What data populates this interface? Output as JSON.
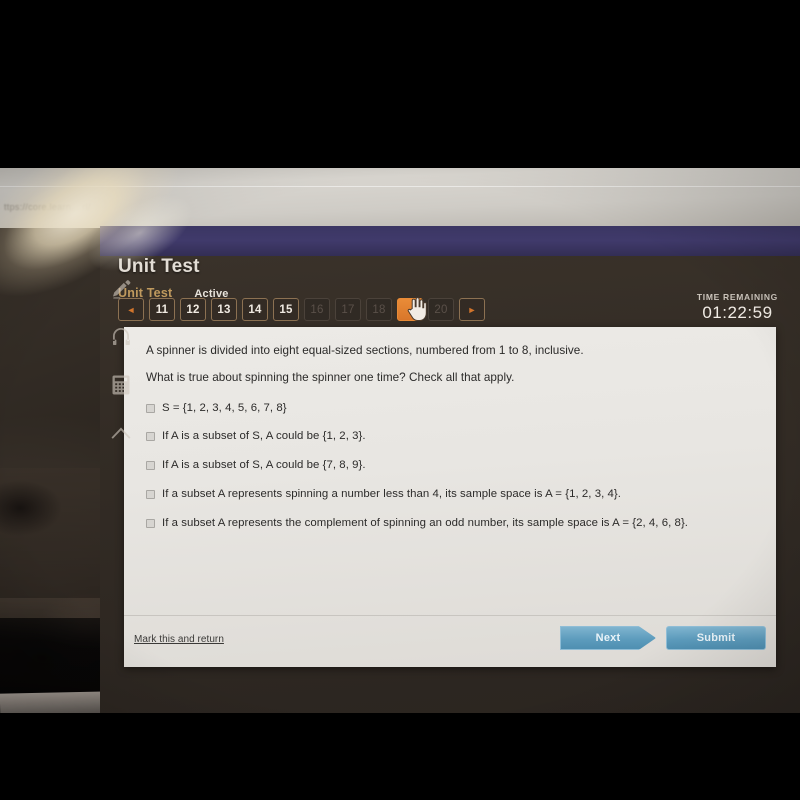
{
  "browser": {
    "url_fragment": "ttps://core.learn...                             rl/"
  },
  "app": {
    "page_title": "Unit Test",
    "tabs": [
      {
        "label": "Unit Test",
        "name": "tab-unit-test",
        "color": "#c09a5e"
      },
      {
        "label": "Active",
        "name": "tab-status",
        "color": "#e8e3db"
      }
    ],
    "pagination": {
      "prev_icon": "◄",
      "next_icon": "►",
      "pages": [
        {
          "label": "11",
          "state": "available"
        },
        {
          "label": "12",
          "state": "available"
        },
        {
          "label": "13",
          "state": "available"
        },
        {
          "label": "14",
          "state": "available"
        },
        {
          "label": "15",
          "state": "available"
        },
        {
          "label": "16",
          "state": "disabled"
        },
        {
          "label": "17",
          "state": "disabled"
        },
        {
          "label": "18",
          "state": "disabled"
        },
        {
          "label": "19",
          "state": "current"
        },
        {
          "label": "20",
          "state": "disabled"
        }
      ],
      "current_page": "19",
      "accent_color": "#e98b37"
    },
    "timer": {
      "label": "TIME REMAINING",
      "value": "01:22:59"
    },
    "tools": [
      {
        "name": "highlighter-icon",
        "label": "Highlighter"
      },
      {
        "name": "headphones-icon",
        "label": "Audio"
      },
      {
        "name": "calculator-icon",
        "label": "Calculator"
      },
      {
        "name": "collapse-up-icon",
        "label": "Collapse"
      }
    ]
  },
  "question": {
    "stem_lines": [
      "A spinner is divided into eight equal-sized sections, numbered from 1 to 8, inclusive.",
      "What is true about spinning the spinner one time? Check all that apply."
    ],
    "options": [
      {
        "text": "S = {1, 2, 3, 4, 5, 6, 7, 8}",
        "checked": false
      },
      {
        "text": "If A is a subset of S, A could be {1, 2, 3}.",
        "checked": false
      },
      {
        "text": "If A is a subset of S, A could be {7, 8, 9}.",
        "checked": false
      },
      {
        "text": "If a subset A represents spinning a number less than 4, its sample space is A = {1, 2, 3, 4}.",
        "checked": false
      },
      {
        "text": "If a subset A represents the complement of spinning an odd number, its sample space is A = {2, 4, 6, 8}.",
        "checked": false
      }
    ]
  },
  "footer": {
    "mark_link": "Mark this and return",
    "next_label": "Next",
    "submit_label": "Submit",
    "button_color": "#5d9cbd"
  }
}
